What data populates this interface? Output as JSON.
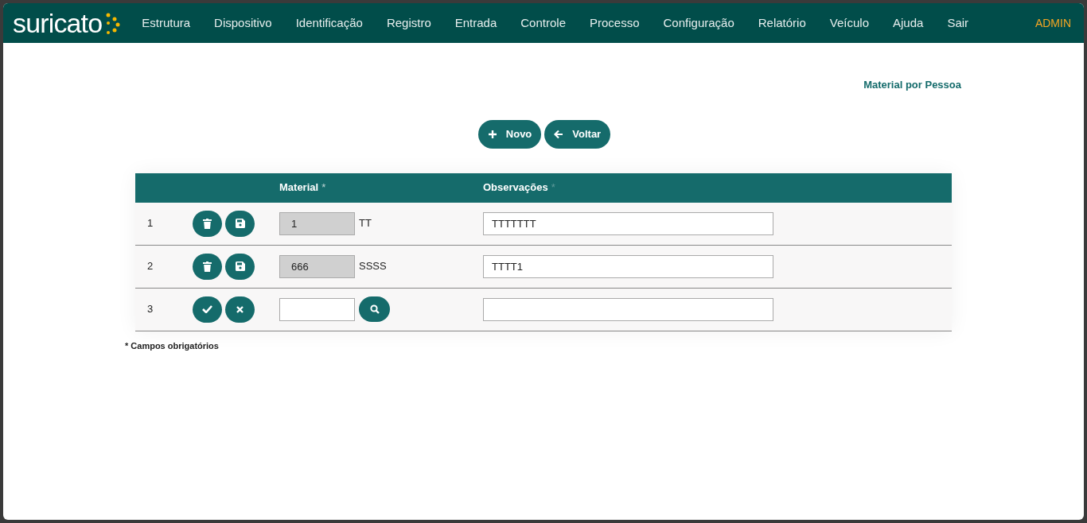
{
  "brand": "suricato",
  "nav": [
    "Estrutura",
    "Dispositivo",
    "Identificação",
    "Registro",
    "Entrada",
    "Controle",
    "Processo",
    "Configuração",
    "Relatório",
    "Veículo",
    "Ajuda",
    "Sair"
  ],
  "user": "ADMIN",
  "page_title": "Material por Pessoa",
  "buttons": [
    {
      "kind": "add",
      "label": "Novo"
    },
    {
      "kind": "back",
      "label": "Voltar"
    }
  ],
  "table": {
    "columns": [
      {
        "label": "Material",
        "mark": "*"
      },
      {
        "label": "Observações",
        "mark": "*"
      }
    ],
    "rows": [
      {
        "kind": "saved",
        "number": "1",
        "material": "1",
        "description": "TT",
        "observations": "TTTTTTT"
      },
      {
        "kind": "saved",
        "number": "2",
        "material": "666",
        "description": "SSSS",
        "observations": "TTTT1"
      },
      {
        "kind": "new",
        "number": "3"
      }
    ]
  },
  "footnote": "* Campos obrigatórios"
}
